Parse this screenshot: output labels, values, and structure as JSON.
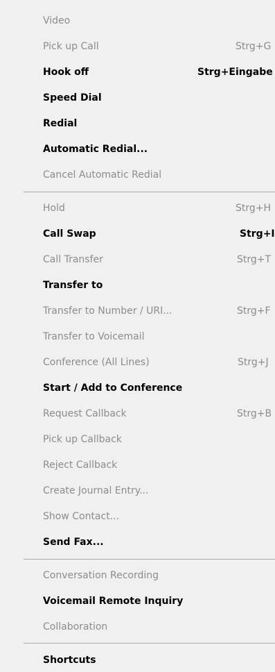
{
  "menu": {
    "items": [
      {
        "label": "Video",
        "shortcut": "",
        "enabled": false
      },
      {
        "label": "Pick up Call",
        "shortcut": "Strg+G",
        "enabled": false
      },
      {
        "label": "Hook off",
        "shortcut": "Strg+Eingabe",
        "enabled": true
      },
      {
        "label": "Speed Dial",
        "shortcut": "",
        "enabled": true
      },
      {
        "label": "Redial",
        "shortcut": "",
        "enabled": true
      },
      {
        "label": "Automatic Redial...",
        "shortcut": "",
        "enabled": true
      },
      {
        "label": "Cancel Automatic Redial",
        "shortcut": "",
        "enabled": false
      },
      {
        "label": "Hold",
        "shortcut": "Strg+H",
        "enabled": false
      },
      {
        "label": "Call Swap",
        "shortcut": "Strg+I",
        "enabled": true
      },
      {
        "label": "Call Transfer",
        "shortcut": "Strg+T",
        "enabled": false
      },
      {
        "label": "Transfer to",
        "shortcut": "",
        "enabled": true
      },
      {
        "label": "Transfer to Number / URI...",
        "shortcut": "Strg+F",
        "enabled": false
      },
      {
        "label": "Transfer to Voicemail",
        "shortcut": "",
        "enabled": false
      },
      {
        "label": "Conference (All Lines)",
        "shortcut": "Strg+J",
        "enabled": false
      },
      {
        "label": "Start / Add to Conference",
        "shortcut": "",
        "enabled": true
      },
      {
        "label": "Request Callback",
        "shortcut": "Strg+B",
        "enabled": false
      },
      {
        "label": "Pick up Callback",
        "shortcut": "",
        "enabled": false
      },
      {
        "label": "Reject Callback",
        "shortcut": "",
        "enabled": false
      },
      {
        "label": "Create Journal Entry...",
        "shortcut": "",
        "enabled": false
      },
      {
        "label": "Show Contact...",
        "shortcut": "",
        "enabled": false
      },
      {
        "label": "Send Fax...",
        "shortcut": "",
        "enabled": true
      },
      {
        "label": "Conversation Recording",
        "shortcut": "",
        "enabled": false
      },
      {
        "label": "Voicemail Remote Inquiry",
        "shortcut": "",
        "enabled": true
      },
      {
        "label": "Collaboration",
        "shortcut": "",
        "enabled": false
      },
      {
        "label": "Shortcuts",
        "shortcut": "",
        "enabled": true
      }
    ]
  }
}
